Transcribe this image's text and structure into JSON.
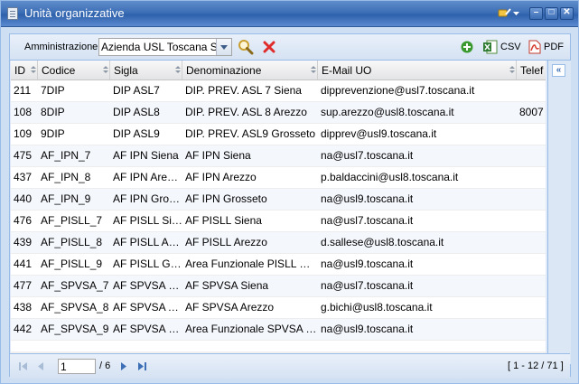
{
  "window": {
    "title": "Unità organizzative"
  },
  "toolbar": {
    "admin_label": "Amministrazione",
    "admin_value": "Azienda USL Toscana Sud",
    "csv_label": "CSV",
    "pdf_label": "PDF"
  },
  "grid": {
    "columns": [
      "ID",
      "Codice",
      "Sigla",
      "Denominazione",
      "E-Mail UO",
      "Telef"
    ],
    "rows": [
      [
        "211",
        "7DIP",
        "DIP ASL7",
        "DIP. PREV. ASL 7 Siena",
        "dipprevenzione@usl7.toscana.it",
        ""
      ],
      [
        "108",
        "8DIP",
        "DIP ASL8",
        "DIP. PREV. ASL 8 Arezzo",
        "sup.arezzo@usl8.toscana.it",
        "8007"
      ],
      [
        "109",
        "9DIP",
        "DIP ASL9",
        "DIP. PREV. ASL9 Grosseto",
        "dipprev@usl9.toscana.it",
        ""
      ],
      [
        "475",
        "AF_IPN_7",
        "AF IPN Siena",
        "AF IPN Siena",
        "na@usl7.toscana.it",
        ""
      ],
      [
        "437",
        "AF_IPN_8",
        "AF IPN Arezzo",
        "AF IPN Arezzo",
        "p.baldaccini@usl8.toscana.it",
        ""
      ],
      [
        "440",
        "AF_IPN_9",
        "AF IPN Grosseto",
        "AF IPN Grosseto",
        "na@usl9.toscana.it",
        ""
      ],
      [
        "476",
        "AF_PISLL_7",
        "AF PISLL Siena",
        "AF PISLL Siena",
        "na@usl7.toscana.it",
        ""
      ],
      [
        "439",
        "AF_PISLL_8",
        "AF PISLL Arezzo",
        "AF PISLL Arezzo",
        "d.sallese@usl8.toscana.it",
        ""
      ],
      [
        "441",
        "AF_PISLL_9",
        "AF PISLL Grosseto",
        "Area Funzionale PISLL Grosseto",
        "na@usl9.toscana.it",
        ""
      ],
      [
        "477",
        "AF_SPVSA_7",
        "AF SPVSA Siena",
        "AF SPVSA Siena",
        "na@usl7.toscana.it",
        ""
      ],
      [
        "438",
        "AF_SPVSA_8",
        "AF SPVSA Arezzo",
        "AF SPVSA Arezzo",
        "g.bichi@usl8.toscana.it",
        ""
      ],
      [
        "442",
        "AF_SPVSA_9",
        "AF SPVSA Grosseto",
        "Area Funzionale SPVSA Grosseto",
        "na@usl9.toscana.it",
        ""
      ]
    ]
  },
  "pager": {
    "page": "1",
    "of_pages": "/ 6",
    "range": "[ 1 - 12 / 71 ]"
  },
  "colors": {
    "title_bar": "#3d6fb6",
    "border": "#99bbe8",
    "delete": "#e02b2b",
    "add": "#3a9a2f"
  }
}
